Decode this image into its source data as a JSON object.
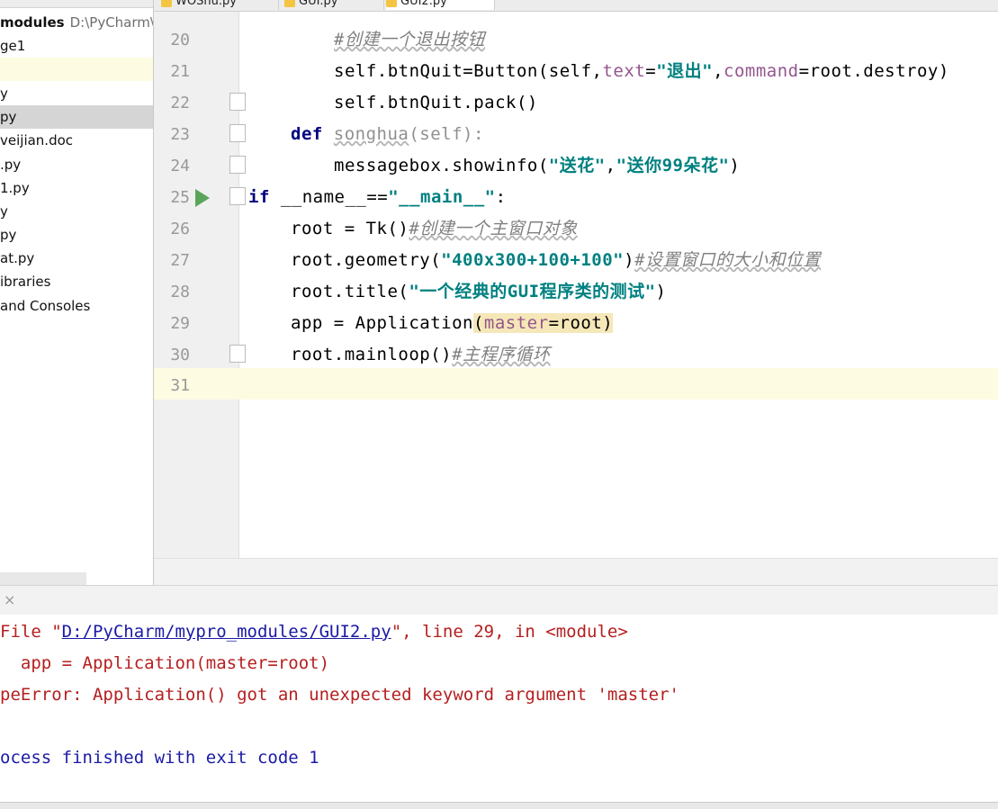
{
  "project": {
    "root_name": "modules",
    "root_path": "D:\\PyCharm\\my",
    "items": [
      {
        "label": "ge1"
      },
      {
        "label": ""
      },
      {
        "label": "y"
      },
      {
        "label": "py"
      },
      {
        "label": "veijian.doc"
      },
      {
        "label": ".py"
      },
      {
        "label": "1.py"
      },
      {
        "label": "y"
      },
      {
        "label": "py"
      },
      {
        "label": "at.py"
      },
      {
        "label": "ibraries"
      },
      {
        "label": " and Consoles"
      }
    ]
  },
  "tabs": [
    {
      "label": "WOShu.py"
    },
    {
      "label": "GUI.py"
    },
    {
      "label": "GUI2.py"
    }
  ],
  "editor": {
    "current_line": "31",
    "lines": [
      {
        "n": "20",
        "t1": "#创建一个退出按钮"
      },
      {
        "n": "21",
        "t1": "self.btnQuit=Button(self,",
        "t2": "text",
        "t3": "=",
        "t4": "\"退出\"",
        "t5": ",",
        "t6": "command",
        "t7": "=root.destroy)"
      },
      {
        "n": "22",
        "t1": "self.btnQuit.pack()"
      },
      {
        "n": "23",
        "t1": "def",
        "t2": "songhua",
        "t3": "(self):"
      },
      {
        "n": "24",
        "t1": "messagebox.showinfo(",
        "t2": "\"送花\"",
        "t3": ",",
        "t4": "\"送你99朵花\"",
        "t5": ")"
      },
      {
        "n": "25",
        "t1": "if",
        "t2": " __name__==",
        "t3": "\"__main__\"",
        "t4": ":"
      },
      {
        "n": "26",
        "t1": "root = Tk()",
        "t2": "#创建一个主窗口对象"
      },
      {
        "n": "27",
        "t1": "root.geometry(",
        "t2": "\"400x300+100+100\"",
        "t3": ")",
        "t4": "#设置窗口的大小和位置"
      },
      {
        "n": "28",
        "t1": "root.title(",
        "t2": "\"一个经典的GUI程序类的测试\"",
        "t3": ")"
      },
      {
        "n": "29",
        "t1": "app = Application",
        "t2": "(",
        "t3": "master",
        "t4": "=root",
        "t5": ")"
      },
      {
        "n": "30",
        "t1": "root.mainloop()",
        "t2": "#主程序循环"
      },
      {
        "n": "31",
        "t1": ""
      }
    ]
  },
  "console": {
    "close_glyph": "×",
    "l1_a": "File \"",
    "l1_link": "D:/PyCharm/mypro_modules/GUI2.py",
    "l1_b": "\", line 29, in <module>",
    "l2": "  app = Application(master=root)",
    "l3": "peError: Application() got an unexpected keyword argument 'master'",
    "l4": "ocess finished with exit code 1"
  },
  "colors": {
    "comment": "#808080",
    "string": "#008080",
    "keyword": "#000080",
    "param": "#94558d",
    "current_line": "#fdfbe1",
    "error": "#b51f1f",
    "console_blue": "#1a1aa6",
    "run_green": "#5aa55a"
  }
}
